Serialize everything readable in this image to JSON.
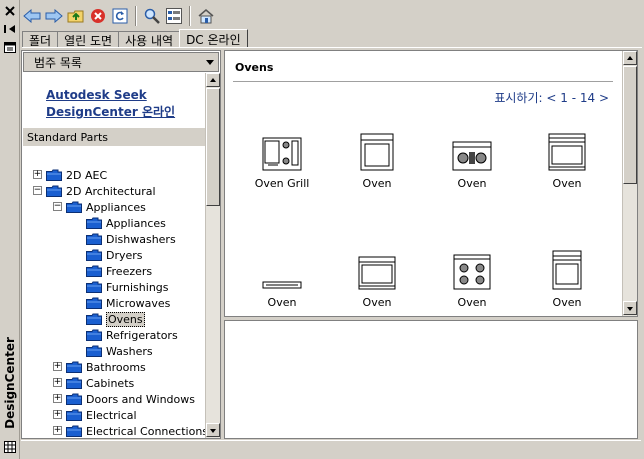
{
  "window": {
    "title": "DesignCenter"
  },
  "tabs": [
    {
      "label": "폴더",
      "active": false
    },
    {
      "label": "열린 도면",
      "active": false
    },
    {
      "label": "사용 내역",
      "active": false
    },
    {
      "label": "DC 온라인",
      "active": true
    }
  ],
  "toolbar": {
    "back": "arrow-left-icon",
    "forward": "arrow-right-icon",
    "up": "folder-up-icon",
    "stop": "stop-icon",
    "reload": "reload-icon",
    "search": "search-icon",
    "view": "tree-view-icon",
    "home": "home-icon"
  },
  "left": {
    "dropdown": "범주 목록",
    "links": [
      "Autodesk Seek",
      "DesignCenter 온라인"
    ],
    "section": "Standard Parts",
    "tree": [
      {
        "label": "2D AEC",
        "level": 0,
        "expander": "+"
      },
      {
        "label": "2D Architectural",
        "level": 0,
        "expander": "-"
      },
      {
        "label": "Appliances",
        "level": 1,
        "expander": "-"
      },
      {
        "label": "Appliances",
        "level": 2
      },
      {
        "label": "Dishwashers",
        "level": 2
      },
      {
        "label": "Dryers",
        "level": 2
      },
      {
        "label": "Freezers",
        "level": 2
      },
      {
        "label": "Furnishings",
        "level": 2
      },
      {
        "label": "Microwaves",
        "level": 2
      },
      {
        "label": "Ovens",
        "level": 2,
        "selected": true
      },
      {
        "label": "Refrigerators",
        "level": 2
      },
      {
        "label": "Washers",
        "level": 2
      },
      {
        "label": "Bathrooms",
        "level": 1,
        "expander": "+"
      },
      {
        "label": "Cabinets",
        "level": 1,
        "expander": "+"
      },
      {
        "label": "Doors and Windows",
        "level": 1,
        "expander": "+"
      },
      {
        "label": "Electrical",
        "level": 1,
        "expander": "+"
      },
      {
        "label": "Electrical Connections",
        "level": 1,
        "expander": "+"
      }
    ]
  },
  "right": {
    "title": "Ovens",
    "count_label": "표시하기:",
    "count_range": "< 1 - 14 >",
    "items": [
      {
        "label": "Oven Grill",
        "icon": "oven-grill-icon"
      },
      {
        "label": "Oven",
        "icon": "oven-front-icon"
      },
      {
        "label": "Oven",
        "icon": "oven-cooktop-icon"
      },
      {
        "label": "Oven",
        "icon": "oven-range-icon"
      },
      {
        "label": "Oven",
        "icon": "oven-slim-icon"
      },
      {
        "label": "Oven",
        "icon": "oven-panel-icon"
      },
      {
        "label": "Oven",
        "icon": "oven-burners-icon"
      },
      {
        "label": "Oven",
        "icon": "oven-tall-icon"
      }
    ]
  },
  "colors": {
    "link": "#1f3c88",
    "folder": "#1a5fd0",
    "chrome": "#d4d0c8"
  }
}
